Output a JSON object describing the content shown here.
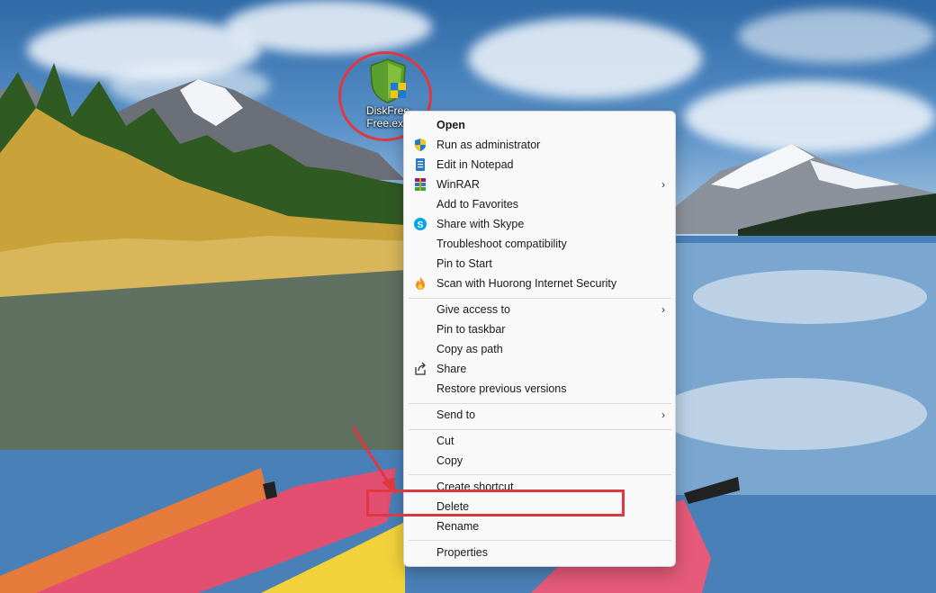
{
  "desktop": {
    "icon": {
      "name": "shield-icon",
      "label_line1": "DiskFree",
      "label_line2": "Free.exe"
    }
  },
  "context_menu": {
    "items": [
      {
        "label": "Open",
        "icon": "",
        "bold": true,
        "submenu": false
      },
      {
        "label": "Run as administrator",
        "icon": "uac-shield-icon",
        "submenu": false
      },
      {
        "label": "Edit in Notepad",
        "icon": "notepad-icon",
        "submenu": false
      },
      {
        "label": "WinRAR",
        "icon": "winrar-icon",
        "submenu": true
      },
      {
        "label": "Add to Favorites",
        "icon": "",
        "submenu": false
      },
      {
        "label": "Share with Skype",
        "icon": "skype-icon",
        "submenu": false
      },
      {
        "label": "Troubleshoot compatibility",
        "icon": "",
        "submenu": false
      },
      {
        "label": "Pin to Start",
        "icon": "",
        "submenu": false
      },
      {
        "label": "Scan with Huorong Internet Security",
        "icon": "huorong-icon",
        "submenu": false
      },
      {
        "label": "Give access to",
        "icon": "",
        "submenu": true
      },
      {
        "label": "Pin to taskbar",
        "icon": "",
        "submenu": false
      },
      {
        "label": "Copy as path",
        "icon": "",
        "submenu": false
      },
      {
        "label": "Share",
        "icon": "share-icon",
        "submenu": false
      },
      {
        "label": "Restore previous versions",
        "icon": "",
        "submenu": false
      },
      {
        "label": "Send to",
        "icon": "",
        "submenu": true
      },
      {
        "label": "Cut",
        "icon": "",
        "submenu": false
      },
      {
        "label": "Copy",
        "icon": "",
        "submenu": false
      },
      {
        "label": "Create shortcut",
        "icon": "",
        "submenu": false
      },
      {
        "label": "Delete",
        "icon": "",
        "submenu": false,
        "highlighted_by_annotation": true
      },
      {
        "label": "Rename",
        "icon": "",
        "submenu": false
      },
      {
        "label": "Properties",
        "icon": "",
        "submenu": false
      }
    ],
    "submenu_arrow": "›"
  },
  "annotations": {
    "color": "#e0383e",
    "circled_item": "desktop-icon",
    "boxed_item": "Delete"
  }
}
